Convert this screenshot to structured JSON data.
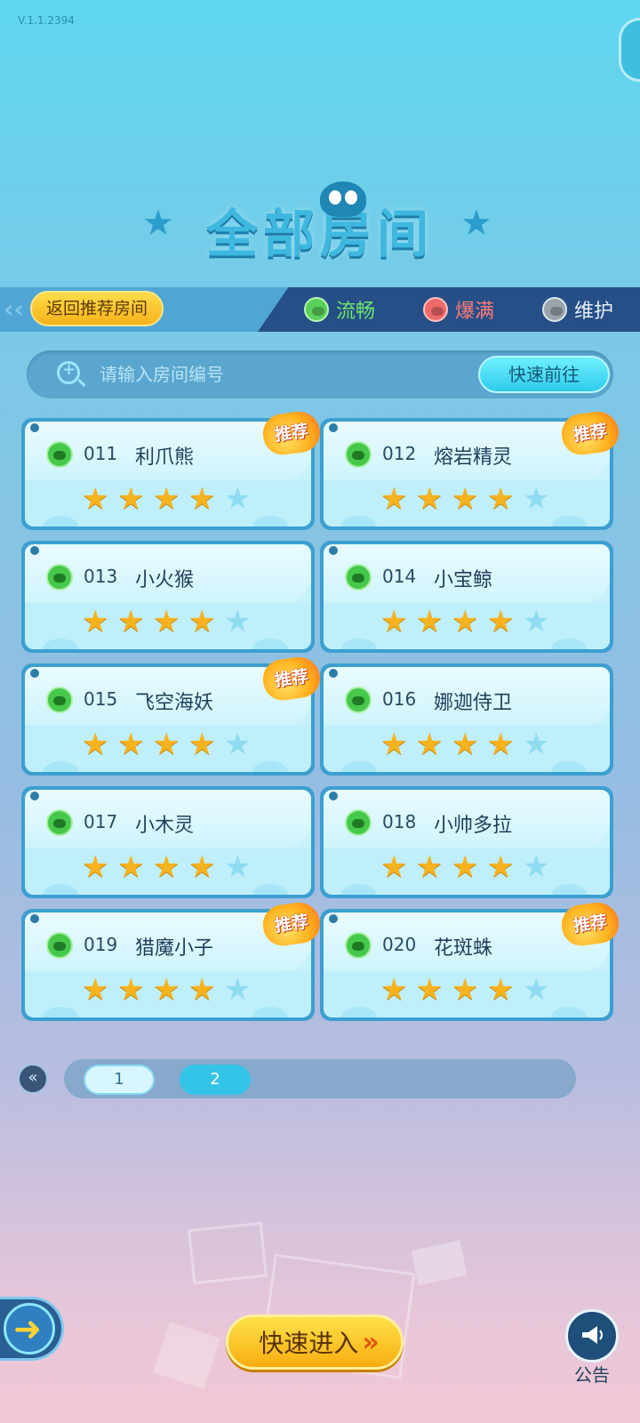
{
  "app": {
    "version": "V.1.1.2394",
    "title": "全部房间"
  },
  "status_bar": {
    "back_label": "返回推荐房间",
    "legend": [
      {
        "label": "流畅",
        "color": "#5ad05a"
      },
      {
        "label": "爆满",
        "color": "#f06a6a"
      },
      {
        "label": "维护",
        "color": "#9aa4ad"
      }
    ]
  },
  "search": {
    "placeholder": "请输入房间编号",
    "button_label": "快速前往"
  },
  "rooms": [
    {
      "number": "011",
      "name": "利爪熊",
      "stars": 4,
      "max_stars": 5,
      "recommended": true,
      "status": "流畅"
    },
    {
      "number": "012",
      "name": "熔岩精灵",
      "stars": 4,
      "max_stars": 5,
      "recommended": true,
      "status": "流畅"
    },
    {
      "number": "013",
      "name": "小火猴",
      "stars": 4,
      "max_stars": 5,
      "recommended": false,
      "status": "流畅"
    },
    {
      "number": "014",
      "name": "小宝鲸",
      "stars": 4,
      "max_stars": 5,
      "recommended": false,
      "status": "流畅"
    },
    {
      "number": "015",
      "name": "飞空海妖",
      "stars": 4,
      "max_stars": 5,
      "recommended": true,
      "status": "流畅"
    },
    {
      "number": "016",
      "name": "娜迦侍卫",
      "stars": 4,
      "max_stars": 5,
      "recommended": false,
      "status": "流畅"
    },
    {
      "number": "017",
      "name": "小木灵",
      "stars": 4,
      "max_stars": 5,
      "recommended": false,
      "status": "流畅"
    },
    {
      "number": "018",
      "name": "小帅多拉",
      "stars": 4,
      "max_stars": 5,
      "recommended": false,
      "status": "流畅"
    },
    {
      "number": "019",
      "name": "猎魔小子",
      "stars": 4,
      "max_stars": 5,
      "recommended": true,
      "status": "流畅"
    },
    {
      "number": "020",
      "name": "花斑蛛",
      "stars": 4,
      "max_stars": 5,
      "recommended": true,
      "status": "流畅"
    }
  ],
  "recommend_badge": "推荐",
  "pagination": {
    "pages": [
      "1",
      "2"
    ],
    "current": "2"
  },
  "bottom": {
    "quick_enter_label": "快速进入",
    "announce_label": "公告"
  }
}
